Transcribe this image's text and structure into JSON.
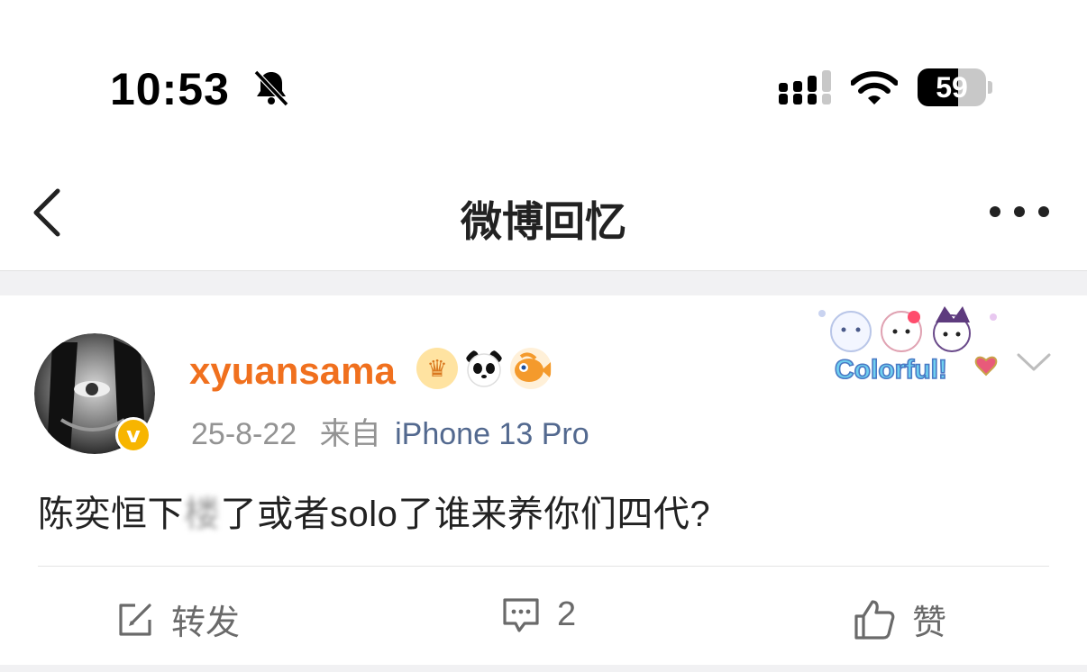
{
  "status_bar": {
    "time": "10:53",
    "battery": 59,
    "icons": [
      "bell-slash-icon",
      "signal-icon",
      "wifi-icon",
      "battery-icon"
    ]
  },
  "nav": {
    "title": "微博回忆",
    "icons": [
      "back-icon",
      "more-icon"
    ]
  },
  "post": {
    "username": "xyuansama",
    "badges": [
      "crown-badge",
      "panda-badge",
      "fish-badge"
    ],
    "date": "25-8-22",
    "source_prefix": "来自",
    "source": "iPhone 13 Pro",
    "sticker_text": "Colorful!",
    "text_before": "陈奕恒下",
    "text_blurred": "楼",
    "text_after": "了或者solo了谁来养你们四代?",
    "actions": {
      "repost_label": "转发",
      "comment_count": "2",
      "like_label": "赞"
    }
  },
  "colors": {
    "username": "#f0701e",
    "source": "#53698f",
    "verified": "#f7b500",
    "meta": "#939393"
  }
}
